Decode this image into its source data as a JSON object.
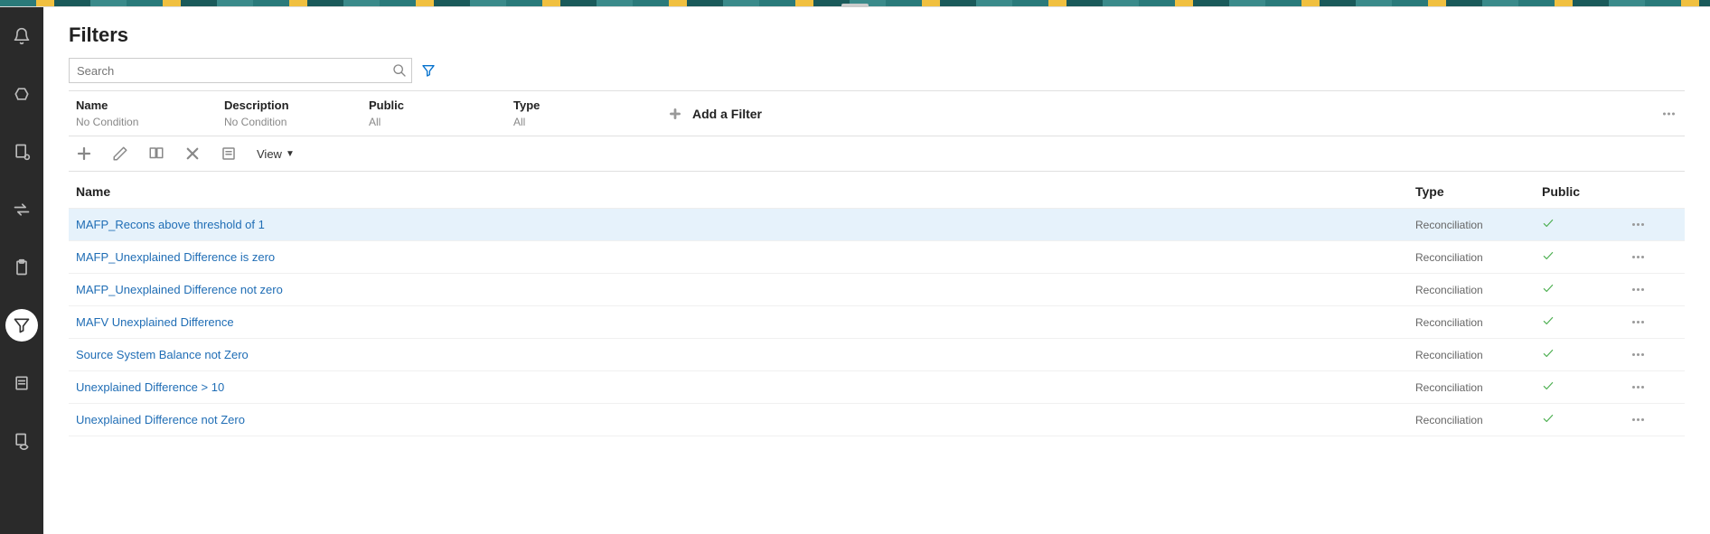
{
  "page_title": "Filters",
  "search": {
    "placeholder": "Search"
  },
  "filter_columns": [
    {
      "label": "Name",
      "value": "No Condition"
    },
    {
      "label": "Description",
      "value": "No Condition"
    },
    {
      "label": "Public",
      "value": "All"
    },
    {
      "label": "Type",
      "value": "All"
    }
  ],
  "add_filter_label": "Add a Filter",
  "view_label": "View",
  "table": {
    "headers": {
      "name": "Name",
      "type": "Type",
      "public": "Public"
    },
    "rows": [
      {
        "name": "MAFP_Recons above threshold of 1",
        "type": "Reconciliation",
        "public": true,
        "selected": true
      },
      {
        "name": "MAFP_Unexplained Difference is zero",
        "type": "Reconciliation",
        "public": true,
        "selected": false
      },
      {
        "name": "MAFP_Unexplained Difference not zero",
        "type": "Reconciliation",
        "public": true,
        "selected": false
      },
      {
        "name": "MAFV Unexplained Difference",
        "type": "Reconciliation",
        "public": true,
        "selected": false
      },
      {
        "name": "Source System Balance not Zero",
        "type": "Reconciliation",
        "public": true,
        "selected": false
      },
      {
        "name": "Unexplained Difference > 10",
        "type": "Reconciliation",
        "public": true,
        "selected": false
      },
      {
        "name": "Unexplained Difference not Zero",
        "type": "Reconciliation",
        "public": true,
        "selected": false
      }
    ]
  }
}
